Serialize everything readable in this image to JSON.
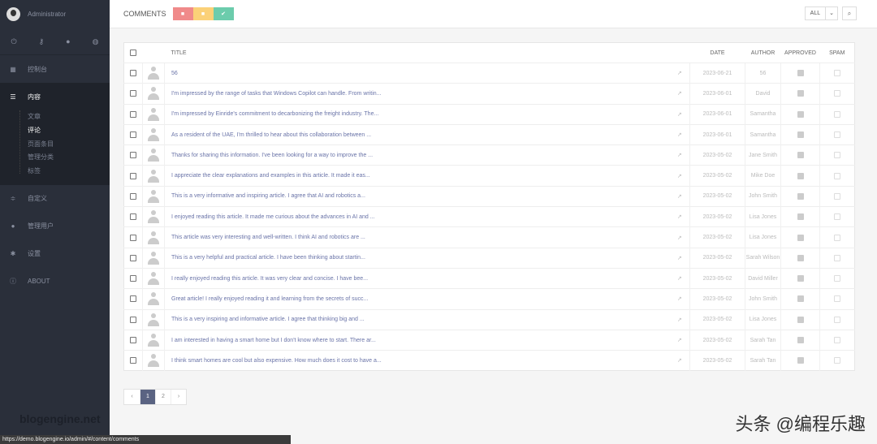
{
  "sidebar": {
    "user": "Administrator",
    "top_icons": [
      "power-icon",
      "key-icon",
      "user-icon",
      "globe-icon"
    ],
    "items": [
      {
        "label": "控制台",
        "icon": "dashboard-icon"
      },
      {
        "label": "内容",
        "icon": "menu-icon"
      },
      {
        "label": "自定义",
        "icon": "sliders-icon"
      },
      {
        "label": "管理用户",
        "icon": "user-icon"
      },
      {
        "label": "设置",
        "icon": "gear-icon"
      },
      {
        "label": "ABOUT",
        "icon": "info-icon"
      }
    ],
    "content_sub": [
      "文章",
      "评论",
      "页面条目",
      "管理分类",
      "标签"
    ],
    "logo": "blogengine.net"
  },
  "header": {
    "title": "COMMENTS",
    "filter": "ALL",
    "colors": {
      "delete": "#f08a8a",
      "pending": "#fbd178",
      "approve": "#6cccac"
    }
  },
  "table": {
    "headers": {
      "title": "TITLE",
      "date": "DATE",
      "author": "AUTHOR",
      "approved": "APPROVED",
      "spam": "SPAM"
    },
    "rows": [
      {
        "title": "56",
        "date": "2023-06-21",
        "author": "56"
      },
      {
        "title": "I'm impressed by the range of tasks that Windows Copilot can handle. From writin...",
        "date": "2023-06-01",
        "author": "David"
      },
      {
        "title": "I'm impressed by Einride's commitment to decarbonizing the freight industry. The...",
        "date": "2023-06-01",
        "author": "Samantha"
      },
      {
        "title": "As a resident of the UAE, I'm thrilled to hear about this collaboration between ...",
        "date": "2023-06-01",
        "author": "Samantha"
      },
      {
        "title": "Thanks for sharing this information. I've been looking for a way to improve the ...",
        "date": "2023-05-02",
        "author": "Jane Smith"
      },
      {
        "title": "I appreciate the clear explanations and examples in this article. It made it eas...",
        "date": "2023-05-02",
        "author": "Mike Doe"
      },
      {
        "title": "This is a very informative and inspiring article. I agree that AI and robotics a...",
        "date": "2023-05-02",
        "author": "John Smith"
      },
      {
        "title": "I enjoyed reading this article. It made me curious about the advances in AI and ...",
        "date": "2023-05-02",
        "author": "Lisa Jones"
      },
      {
        "title": "This article was very interesting and well-written. I think AI and robotics are ...",
        "date": "2023-05-02",
        "author": "Lisa Jones"
      },
      {
        "title": "This is a very helpful and practical article. I have been thinking about startin...",
        "date": "2023-05-02",
        "author": "Sarah Wilson"
      },
      {
        "title": "I really enjoyed reading this article. It was very clear and concise. I have bee...",
        "date": "2023-05-02",
        "author": "David Miller"
      },
      {
        "title": "Great article! I really enjoyed reading it and learning from the secrets of succ...",
        "date": "2023-05-02",
        "author": "John Smith"
      },
      {
        "title": "This is a very inspiring and informative article. I agree that thinking big and ...",
        "date": "2023-05-02",
        "author": "Lisa Jones"
      },
      {
        "title": "I am interested in having a smart home but I don't know where to start. There ar...",
        "date": "2023-05-02",
        "author": "Sarah Tan"
      },
      {
        "title": "I think smart homes are cool but also expensive. How much does it cost to have a...",
        "date": "2023-05-02",
        "author": "Sarah Tan"
      }
    ]
  },
  "pagination": {
    "prev": "‹",
    "pages": [
      "1",
      "2"
    ],
    "current": "1",
    "next": "›"
  },
  "status_url": "https://demo.blogengine.io/admin/#/content/comments",
  "watermark": "头条 @编程乐趣"
}
